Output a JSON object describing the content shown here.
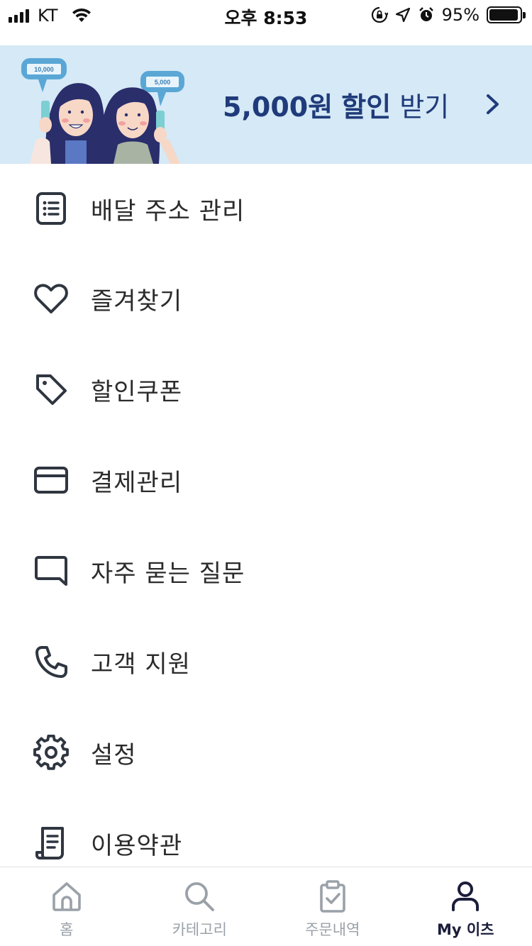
{
  "status_bar": {
    "carrier": "KT",
    "time": "오후 8:53",
    "battery": "95%",
    "battery_level": 0.95
  },
  "banner": {
    "amount": "5,000원",
    "discount": "할인",
    "receive": "받기",
    "bubble_left": "10,000",
    "bubble_right": "5,000",
    "text_color": "#1f3b7a",
    "background": "#d5e9f6"
  },
  "menu": {
    "items": [
      {
        "label": "배달 주소 관리",
        "icon": "address-list-icon"
      },
      {
        "label": "즐겨찾기",
        "icon": "heart-icon"
      },
      {
        "label": "할인쿠폰",
        "icon": "tag-icon"
      },
      {
        "label": "결제관리",
        "icon": "credit-card-icon"
      },
      {
        "label": "자주 묻는 질문",
        "icon": "chat-bubble-icon"
      },
      {
        "label": "고객 지원",
        "icon": "phone-icon"
      },
      {
        "label": "설정",
        "icon": "gear-icon"
      },
      {
        "label": "이용약관",
        "icon": "document-icon"
      }
    ]
  },
  "tabs": [
    {
      "label": "홈",
      "icon": "home-icon",
      "active": false
    },
    {
      "label": "카테고리",
      "icon": "search-icon",
      "active": false
    },
    {
      "label": "주문내역",
      "icon": "clipboard-check-icon",
      "active": false
    },
    {
      "label": "My 이츠",
      "icon": "person-icon",
      "active": true
    }
  ],
  "colors": {
    "active_tab": "#1b1d3a",
    "inactive_tab": "#9aa1a8",
    "icon_stroke": "#2f3640"
  }
}
